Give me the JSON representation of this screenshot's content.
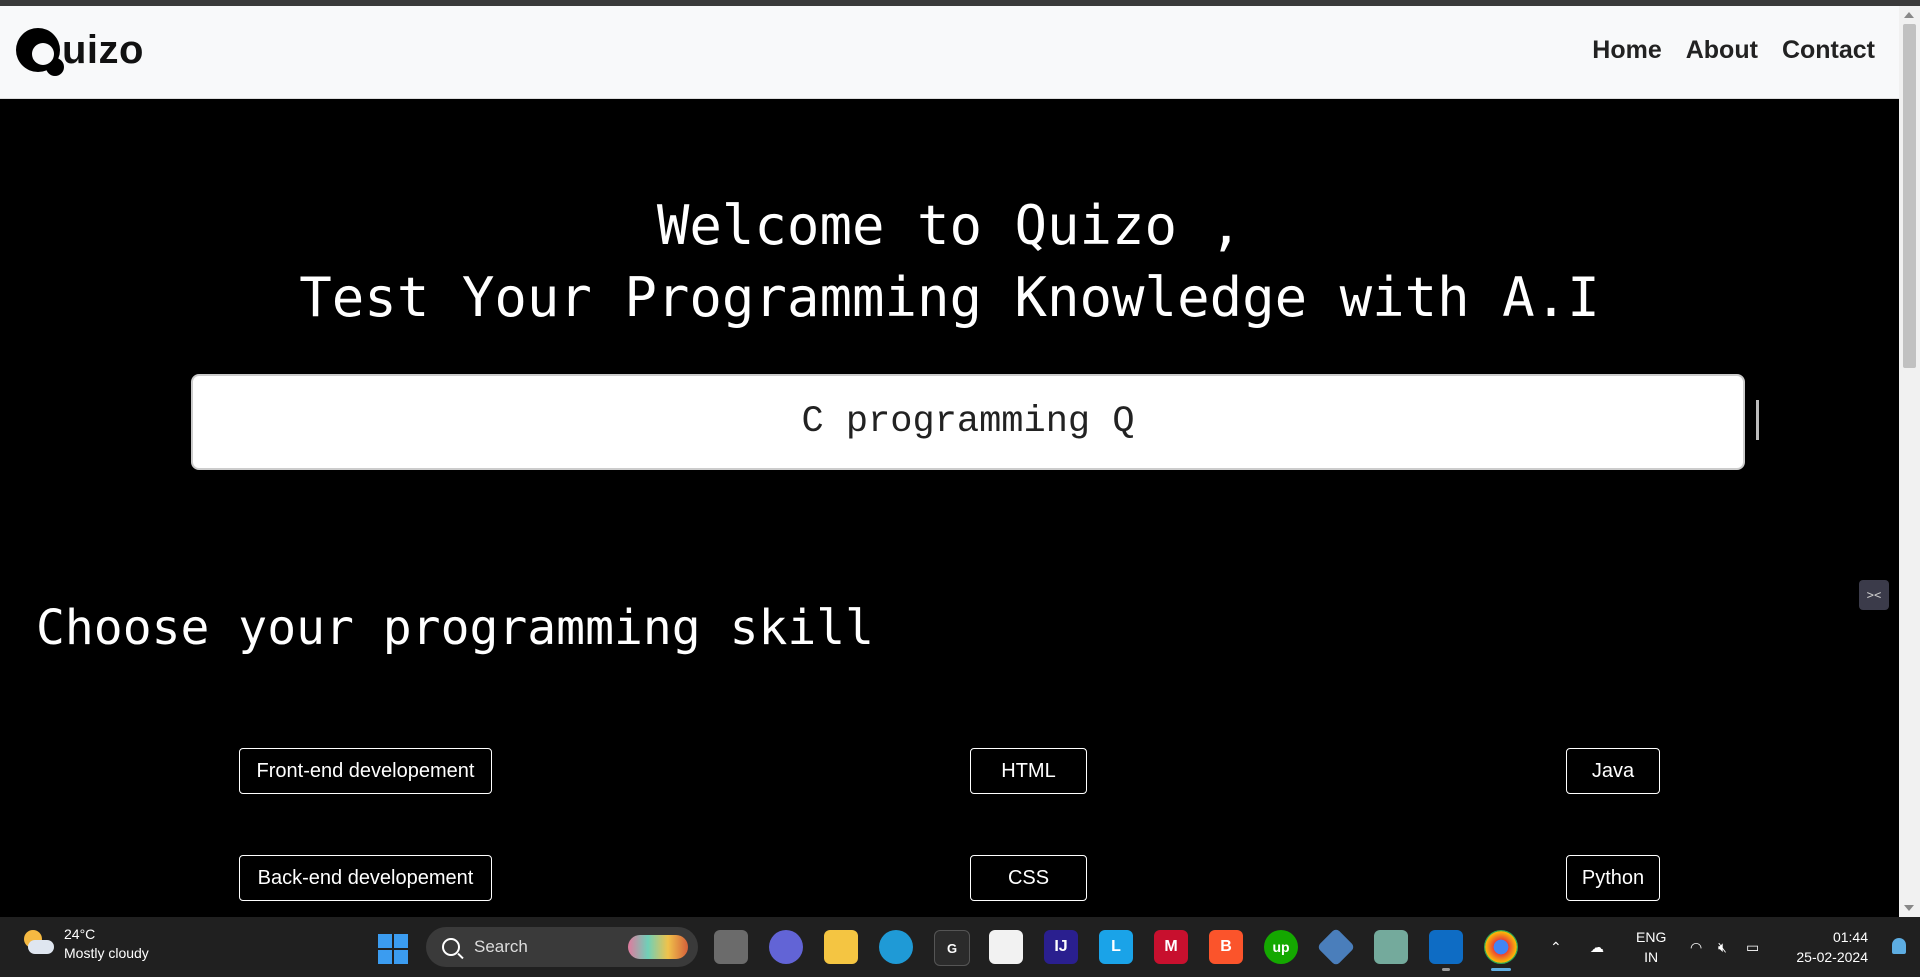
{
  "navbar": {
    "logo_text": "uizo",
    "links": [
      "Home",
      "About",
      "Contact"
    ]
  },
  "hero": {
    "line1": "Welcome to Quizo ,",
    "line2": "Test Your Programming Knowledge with A.I"
  },
  "search": {
    "value": "C programming Q"
  },
  "section": {
    "title": "Choose your programming skill"
  },
  "skills": [
    "Front-end developement",
    "HTML",
    "Java",
    "Back-end developement",
    "CSS",
    "Python"
  ],
  "extension_badge": "><",
  "taskbar": {
    "weather_temp": "24°C",
    "weather_desc": "Mostly cloudy",
    "search_label": "Search",
    "apps": [
      "task-view",
      "teams",
      "file-explorer",
      "edge",
      "g-app",
      "store",
      "intellij",
      "l-app",
      "mcafee",
      "brave",
      "upwork",
      "git",
      "chatgpt",
      "vscode",
      "chrome"
    ],
    "lang_line1": "ENG",
    "lang_line2": "IN",
    "time": "01:44",
    "date": "25-02-2024"
  }
}
